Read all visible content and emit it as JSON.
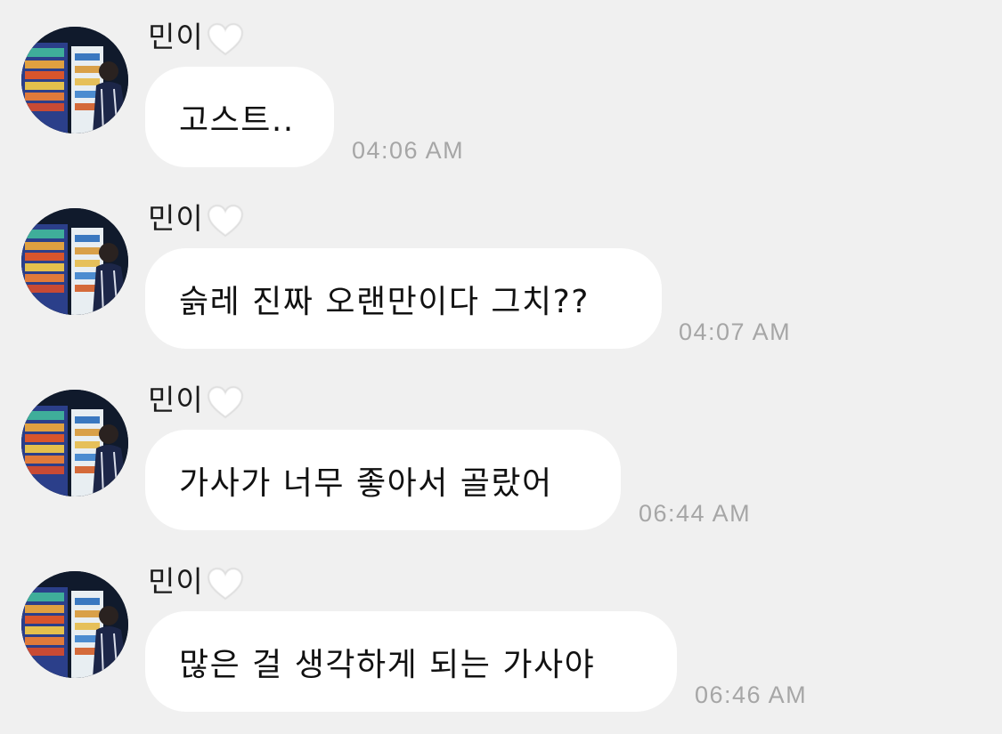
{
  "messages": [
    {
      "sender": "민이",
      "text": "고스트..",
      "time": "04:06 AM"
    },
    {
      "sender": "민이",
      "text": "슭레 진짜 오랜만이다 그치??",
      "time": "04:07 AM"
    },
    {
      "sender": "민이",
      "text": "가사가 너무 좋아서 골랐어",
      "time": "06:44 AM"
    },
    {
      "sender": "민이",
      "text": "많은 걸 생각하게 되는 가사야",
      "time": "06:46 AM"
    }
  ],
  "colors": {
    "background": "#f0f0f0",
    "bubble": "#ffffff",
    "timestamp": "#a6a6a6"
  },
  "icons": {
    "reaction": "white-heart-icon"
  }
}
